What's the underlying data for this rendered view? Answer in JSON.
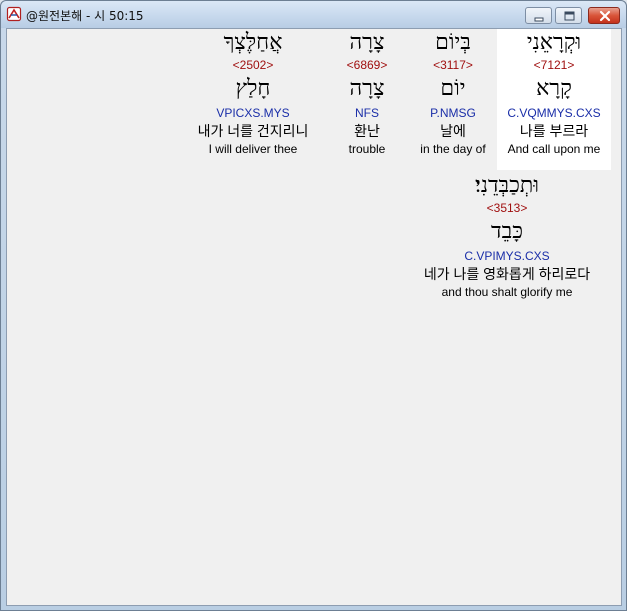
{
  "window": {
    "title": "@원전본해 - 시 50:15"
  },
  "words": [
    {
      "hebrew": "וּקְרָאֵנִי",
      "strong": "<7121>",
      "lemma": "קָרָא",
      "morph": "C.VQMMYS.CXS",
      "korean": "나를 부르라",
      "english": "And call upon me",
      "highlighted": true
    },
    {
      "hebrew": "בְּיוֹם",
      "strong": "<3117>",
      "lemma": "יוֹם",
      "morph": "P.NMSG",
      "korean": "날에",
      "english": "in the day of",
      "highlighted": false
    },
    {
      "hebrew": "צָרָה",
      "strong": "<6869>",
      "lemma": "צָרָה",
      "morph": "NFS",
      "korean": "환난",
      "english": "trouble",
      "highlighted": false
    },
    {
      "hebrew": "אֲחַלֶּצְךָ",
      "strong": "<2502>",
      "lemma": "חָלַץ",
      "morph": "VPICXS.MYS",
      "korean": "내가 너를 건지리니",
      "english": "I will deliver thee",
      "highlighted": false
    },
    {
      "hebrew": "וּתְכַבְּדֵנִי׃",
      "strong": "<3513>",
      "lemma": "כָּבֵד",
      "morph": "C.VPIMYS.CXS",
      "korean": "네가 나를 영화롭게 하리로다",
      "english": "and thou shalt glorify me",
      "highlighted": false
    }
  ]
}
